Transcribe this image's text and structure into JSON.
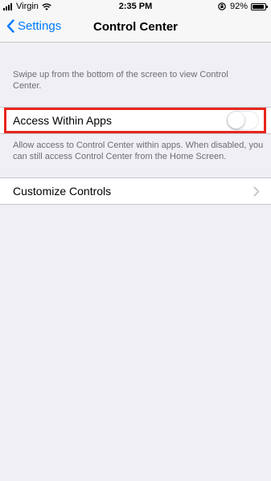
{
  "status_bar": {
    "carrier": "Virgin",
    "time": "2:35 PM",
    "battery_percent": "92%",
    "battery_level": 0.92
  },
  "nav": {
    "back_label": "Settings",
    "title": "Control Center"
  },
  "intro_text": "Swipe up from the bottom of the screen to view Control Center.",
  "access_within_apps": {
    "label": "Access Within Apps",
    "enabled": false,
    "footer": "Allow access to Control Center within apps. When disabled, you can still access Control Center from the Home Screen."
  },
  "customize": {
    "label": "Customize Controls"
  },
  "colors": {
    "accent": "#007aff",
    "highlight": "#e8261c",
    "background": "#efeff4"
  },
  "icons": [
    "cellular-signal-icon",
    "wifi-icon",
    "rotation-lock-icon",
    "battery-icon",
    "back-chevron-icon",
    "disclosure-chevron-icon"
  ]
}
